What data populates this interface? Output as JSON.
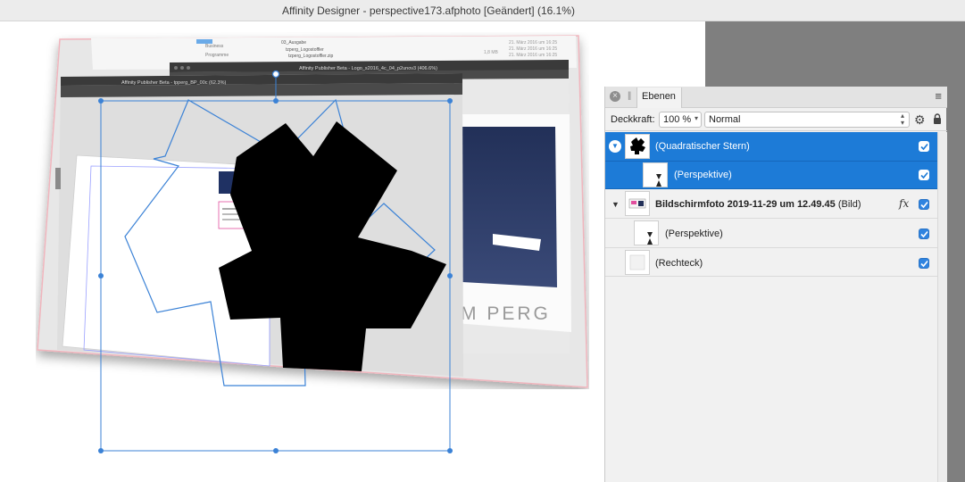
{
  "window": {
    "title": "Affinity Designer - perspective173.afphoto [Geändert] (16.1%)"
  },
  "screenshot_layer": {
    "window_1_title": "Affinity Publisher Beta - Logo_s2016_4c_04_p2unov3 (406.6%)",
    "window_2_title": "Affinity Publisher Beta - tpperg_BP_00c (62.3%)",
    "finder_items": [
      "Business",
      "Programme",
      "03_Ausgabe",
      "tzperg_Logostoffler",
      "tzperg_Logostoffler.zip"
    ],
    "finder_dates": [
      "21. März 2016 um 16:25",
      "21. März 2016 um 16:25",
      "21. März 2016 um 16:25"
    ],
    "finder_size": "1,8 MB",
    "logo_text": "M PERG"
  },
  "layers_panel": {
    "tab_label": "Ebenen",
    "opacity_label": "Deckkraft:",
    "opacity_value": "100 %",
    "blend_mode": "Normal",
    "layers": [
      {
        "name": "(Quadratischer Stern)",
        "selected": true,
        "checked": true
      },
      {
        "name": "(Perspektive)",
        "selected": true,
        "checked": true
      },
      {
        "name_bold": "Bildschirmfoto 2019-11-29 um 12.49.45",
        "name_suffix": " (Bild)",
        "selected": false,
        "checked": true,
        "fx": "fx"
      },
      {
        "name": "(Perspektive)",
        "selected": false,
        "checked": true
      },
      {
        "name": "(Rechteck)",
        "selected": false,
        "checked": true
      }
    ]
  },
  "colors": {
    "selection": "#1d7bd7",
    "checkbox": "#2f84e0",
    "canvas_bg": "#ffffff",
    "side_panel_bg": "#7f7f7f",
    "shape_fill": "#000000",
    "selection_outline": "#3b82d6"
  },
  "icons": [
    "close-icon",
    "grip-icon",
    "panel-menu-icon",
    "gear-icon",
    "lock-icon",
    "disclosure-triangle-icon",
    "checkmark-icon",
    "fx-icon"
  ]
}
